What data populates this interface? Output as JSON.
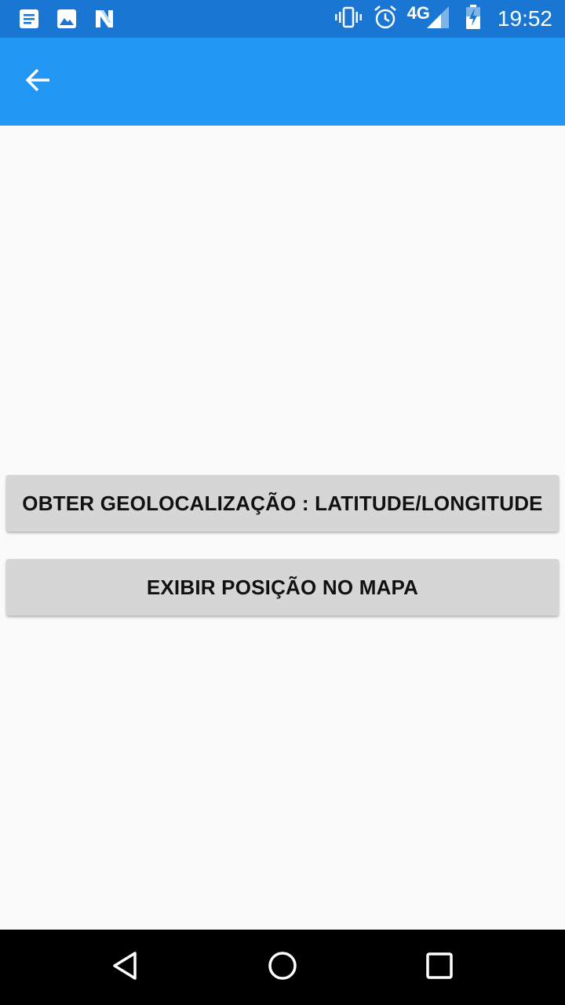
{
  "status_bar": {
    "icons_left": [
      "notification-message-icon",
      "image-icon",
      "n-logo-icon"
    ],
    "icons_right": [
      "vibrate-icon",
      "alarm-icon",
      "signal-icon",
      "battery-charging-icon"
    ],
    "network": "4G",
    "time": "19:52",
    "background_color": "#1976D2"
  },
  "app_bar": {
    "back_icon": "arrow-back-icon",
    "background_color": "#2196F3"
  },
  "main": {
    "buttons": [
      {
        "label": "OBTER GEOLOCALIZAÇÃO : LATITUDE/LONGITUDE"
      },
      {
        "label": "EXIBIR POSIÇÃO NO MAPA"
      }
    ]
  },
  "nav_bar": {
    "icons": [
      "nav-back-icon",
      "nav-home-icon",
      "nav-recents-icon"
    ]
  }
}
